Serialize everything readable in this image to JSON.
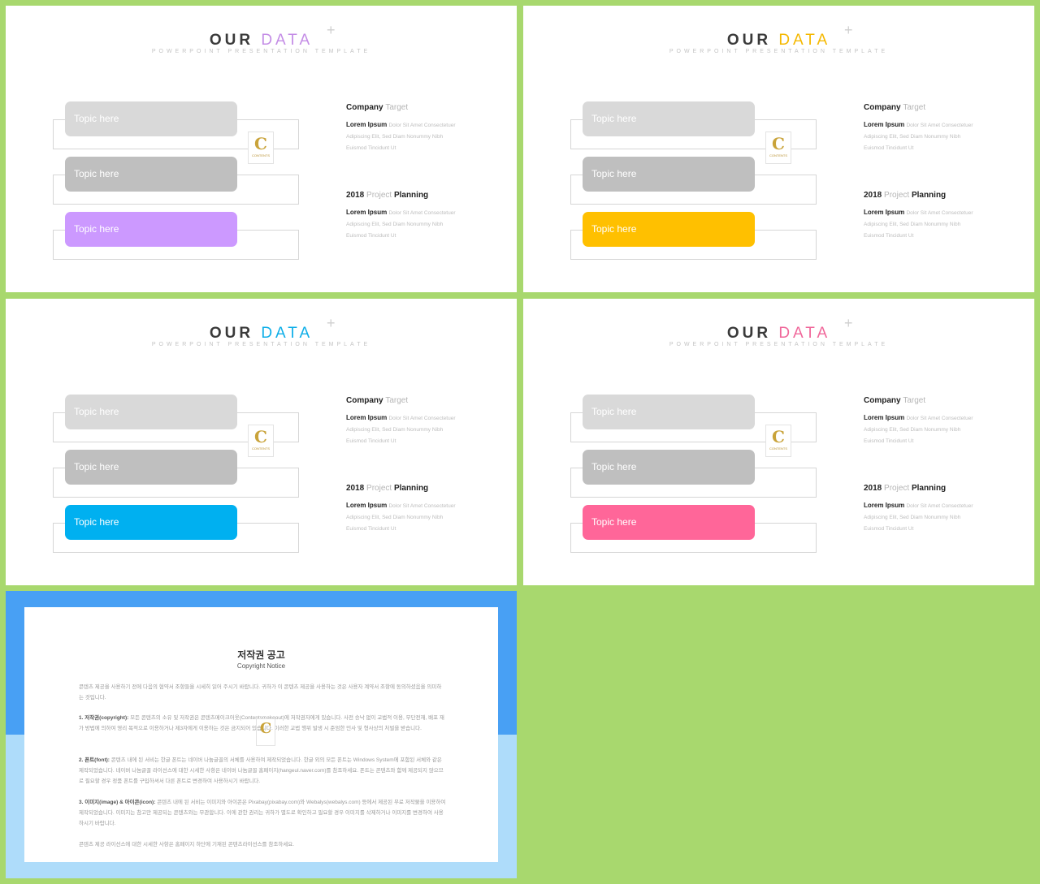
{
  "slides": [
    {
      "title_main": "OUR",
      "title_accent": "DATA",
      "accent_color": "#c48de6",
      "subtitle": "POWERPOINT PRESENTATION TEMPLATE",
      "topics": [
        "Topic here",
        "Topic here",
        "Topic here"
      ],
      "topic_colors": [
        "#d9d9d9",
        "#bfbfbf",
        "#cc99ff"
      ]
    },
    {
      "title_main": "OUR",
      "title_accent": "DATA",
      "accent_color": "#f5b800",
      "subtitle": "POWERPOINT PRESENTATION TEMPLATE",
      "topics": [
        "Topic here",
        "Topic here",
        "Topic here"
      ],
      "topic_colors": [
        "#d9d9d9",
        "#bfbfbf",
        "#ffc000"
      ]
    },
    {
      "title_main": "OUR",
      "title_accent": "DATA",
      "accent_color": "#0eaee8",
      "subtitle": "POWERPOINT PRESENTATION TEMPLATE",
      "topics": [
        "Topic here",
        "Topic here",
        "Topic here"
      ],
      "topic_colors": [
        "#d9d9d9",
        "#bfbfbf",
        "#00b0f0"
      ]
    },
    {
      "title_main": "OUR",
      "title_accent": "DATA",
      "accent_color": "#f0679a",
      "subtitle": "POWERPOINT PRESENTATION TEMPLATE",
      "topics": [
        "Topic here",
        "Topic here",
        "Topic here"
      ],
      "topic_colors": [
        "#d9d9d9",
        "#bfbfbf",
        "#ff6699"
      ]
    }
  ],
  "info": {
    "block1": {
      "head_bold": "Company",
      "head_muted": "Target",
      "lead": "Lorem Ipsum",
      "lead_rest": "Dolor Sit Amet Consectetuer",
      "line2": "Adipiscing Elit, Sed Diam Nonummy  Nibh",
      "line3": "Euismod Tincidunt Ut"
    },
    "block2": {
      "head_bold": "2018",
      "head_muted": "Project",
      "head_bold2": "Planning",
      "lead": "Lorem Ipsum",
      "lead_rest": "Dolor Sit Amet Consectetuer",
      "line2": "Adipiscing Elit, Sed Diam Nonummy  Nibh",
      "line3": "Euismod Tincidunt Ut"
    }
  },
  "logo": {
    "letter": "C",
    "text": "CONTENTS"
  },
  "copyright": {
    "title_kr": "저작권 공고",
    "title_en": "Copyright Notice",
    "intro": "콘텐츠 제공을 사용하기 전에 다음의 협약서 조항들을 시세히 읽어 주시기 바랍니다. 귀하가 이 콘텐츠 제공을 사용하는 것은 사용자 계약서 조항에 동의하셨음을 의미하는 것입니다.",
    "p1_bold": "1. 저작권(copyright):",
    "p1": "모든 콘텐츠의 소유 및 저작권은 콘텐츠메이크어웃(Contentsmakeout)에 저작권자에게 있습니다. 사전 승낙 없이 교법적 이용, 무단전재, 배포 재가 방법에 의하여 영리 목적으로 이용하거나 제3자에게 이용하는 것은 금지되어 있습니다. 이러한 교법 행위 발생 시 준엄한 민사 및 형사상의 처벌을 받습니다.",
    "p2_bold": "2. 폰트(font):",
    "p2": "콘텐츠 내에 된 서비는 한글 폰트는 네이버 나눔글꼴의 서체를 사용하여 제작되었습니다. 한글 외의 모든 폰트는 Windows System에 포함된 서체와 같은 제작되었습니다. 네이버 나눔글꼴 라이선스에 대한 시세한 사항은 네이버 나눔글꼴 홈페이지(hangeul.naver.com)를 참조하세요. 폰트는 콘텐츠와 함께 제공되지 않으므로 필요할 경우 정품 폰트를 구입하셔서 다른 폰트로 변경하여 사용하시기 바랍니다.",
    "p3_bold": "3. 이미지(image) & 아이콘(icon):",
    "p3": "콘텐츠 내에 된 서비는 이미지와 아이콘은 Pixabay(pixabay.com)와 Webalys(webalys.com) 등에서 제공된 무료 저작물을 이용하여 제작되었습니다. 이미지는 참고만 제공되는 콘텐츠와는 무관합니다. 이에 관한 권리는 귀하가 별도로 확인하고 필요할 경우 이미지를 삭제하거나 이미지를 변경하여 사용하시기 바랍니다.",
    "outro": "콘텐츠 제공 라이선스에 대한 시세한 사항은 홈페이지 하단에 기재된 콘텐츠라이선스를 참조하세요."
  }
}
